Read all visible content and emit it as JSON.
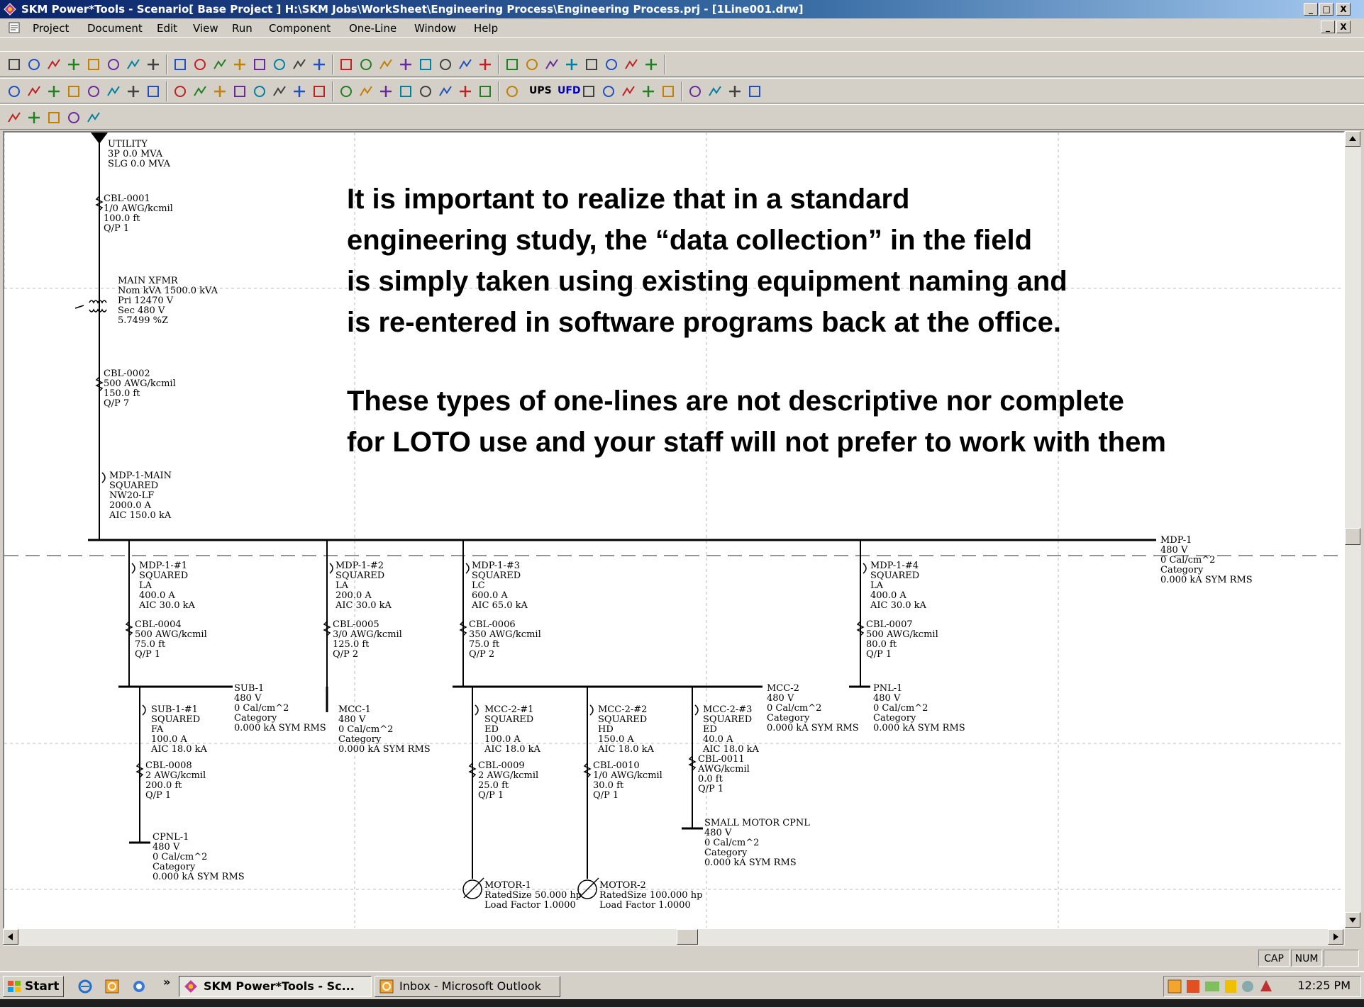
{
  "window": {
    "title": "SKM Power*Tools - Scenario[ Base Project ] H:\\SKM Jobs\\WorkSheet\\Engineering Process\\Engineering Process.prj - [1Line001.drw]",
    "controls": [
      "_",
      "□",
      "X"
    ]
  },
  "menu": {
    "items": [
      "Project",
      "Document",
      "Edit",
      "View",
      "Run",
      "Component",
      "One-Line",
      "Window",
      "Help"
    ]
  },
  "toolbar": {
    "text_labels": [
      "UPS",
      "UFD"
    ]
  },
  "overlay": {
    "para1": [
      "It is important to realize that in a standard",
      "engineering study, the “data collection” in the field",
      "is simply taken using existing equipment naming and",
      "is re-entered in software programs back at the office."
    ],
    "para2": [
      "These types of one-lines are not descriptive nor complete",
      "for LOTO use and your staff will not prefer to work with them"
    ]
  },
  "diagram": {
    "utility": [
      "UTILITY",
      "3P 0.0 MVA",
      "SLG 0.0 MVA"
    ],
    "cbl_0001": [
      "CBL-0001",
      "1/0 AWG/kcmil",
      "100.0 ft",
      "Q/P 1"
    ],
    "main_xfmr": [
      "MAIN XFMR",
      "Nom kVA 1500.0 kVA",
      "Pri 12470 V",
      "Sec 480 V",
      "5.7499 %Z"
    ],
    "cbl_0002": [
      "CBL-0002",
      "500 AWG/kcmil",
      "150.0 ft",
      "Q/P 7"
    ],
    "mdp1_main": [
      "MDP-1-MAIN",
      "SQUARED",
      "NW20-LF",
      "2000.0 A",
      "AIC 150.0 kA"
    ],
    "mdp1_bus": [
      "MDP-1",
      "480 V",
      "0 Cal/cm^2",
      "Category",
      "0.000 kA SYM RMS"
    ],
    "mdp1_1": [
      "MDP-1-#1",
      "SQUARED",
      "LA",
      "400.0 A",
      "AIC 30.0 kA"
    ],
    "mdp1_2": [
      "MDP-1-#2",
      "SQUARED",
      "LA",
      "200.0 A",
      "AIC 30.0 kA"
    ],
    "mdp1_3": [
      "MDP-1-#3",
      "SQUARED",
      "LC",
      "600.0 A",
      "AIC 65.0 kA"
    ],
    "mdp1_4": [
      "MDP-1-#4",
      "SQUARED",
      "LA",
      "400.0 A",
      "AIC 30.0 kA"
    ],
    "cbl_0004": [
      "CBL-0004",
      "500 AWG/kcmil",
      "75.0 ft",
      "Q/P 1"
    ],
    "cbl_0005": [
      "CBL-0005",
      "3/0 AWG/kcmil",
      "125.0 ft",
      "Q/P 2"
    ],
    "cbl_0006": [
      "CBL-0006",
      "350 AWG/kcmil",
      "75.0 ft",
      "Q/P 2"
    ],
    "cbl_0007": [
      "CBL-0007",
      "500 AWG/kcmil",
      "80.0 ft",
      "Q/P 1"
    ],
    "sub1_bus": [
      "SUB-1",
      "480 V",
      "0 Cal/cm^2",
      "Category",
      "0.000 kA SYM RMS"
    ],
    "mcc1_bus": [
      "MCC-1",
      "480 V",
      "0 Cal/cm^2",
      "Category",
      "0.000 kA SYM RMS"
    ],
    "mcc2_bus": [
      "MCC-2",
      "480 V",
      "0 Cal/cm^2",
      "Category",
      "0.000 kA SYM RMS"
    ],
    "pnl1_bus": [
      "PNL-1",
      "480 V",
      "0 Cal/cm^2",
      "Category",
      "0.000 kA SYM RMS"
    ],
    "sub1_1": [
      "SUB-1-#1",
      "SQUARED",
      "FA",
      "100.0 A",
      "AIC 18.0 kA"
    ],
    "mcc2_1": [
      "MCC-2-#1",
      "SQUARED",
      "ED",
      "100.0 A",
      "AIC 18.0 kA"
    ],
    "mcc2_2": [
      "MCC-2-#2",
      "SQUARED",
      "HD",
      "150.0 A",
      "AIC 18.0 kA"
    ],
    "mcc2_3": [
      "MCC-2-#3",
      "SQUARED",
      "ED",
      "40.0 A",
      "AIC 18.0 kA"
    ],
    "cbl_0008": [
      "CBL-0008",
      "2 AWG/kcmil",
      "200.0 ft",
      "Q/P 1"
    ],
    "cbl_0009": [
      "CBL-0009",
      "2 AWG/kcmil",
      "25.0 ft",
      "Q/P 1"
    ],
    "cbl_0010": [
      "CBL-0010",
      "1/0 AWG/kcmil",
      "30.0 ft",
      "Q/P 1"
    ],
    "cbl_0011": [
      "CBL-0011",
      "AWG/kcmil",
      "0.0 ft",
      "Q/P 1"
    ],
    "cpnl1_bus": [
      "CPNL-1",
      "480 V",
      "0 Cal/cm^2",
      "Category",
      "0.000 kA SYM RMS"
    ],
    "small_motor_cpnl": [
      "SMALL MOTOR CPNL",
      "480 V",
      "0 Cal/cm^2",
      "Category",
      "0.000 kA SYM RMS"
    ],
    "motor1": [
      "MOTOR-1",
      "RatedSize 50.000 hp",
      "Load Factor 1.0000"
    ],
    "motor2": [
      "MOTOR-2",
      "RatedSize 100.000 hp",
      "Load Factor 1.0000"
    ]
  },
  "statusbar": {
    "cap": "CAP",
    "num": "NUM"
  },
  "taskbar": {
    "start_label": "Start",
    "overflow": "»",
    "buttons": [
      "SKM Power*Tools - Sc...",
      "Inbox - Microsoft Outlook"
    ],
    "clock": "12:25 PM"
  }
}
